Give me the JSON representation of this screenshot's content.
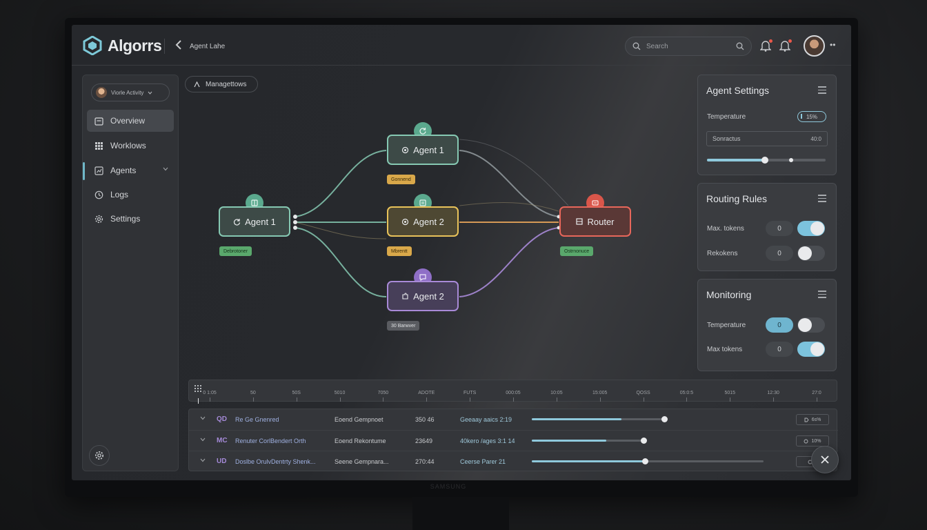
{
  "app": {
    "name": "Algorrs",
    "breadcrumb": "Agent Lahe"
  },
  "search": {
    "placeholder": "Search"
  },
  "sidebar": {
    "workspace": "Viorle Activity",
    "items": [
      {
        "label": "Overview",
        "icon": "calendar-icon"
      },
      {
        "label": "Worklows",
        "icon": "grid-icon"
      },
      {
        "label": "Agents",
        "icon": "chart-icon"
      },
      {
        "label": "Logs",
        "icon": "clock-icon"
      },
      {
        "label": "Settings",
        "icon": "gear-icon"
      }
    ]
  },
  "canvas": {
    "chip": "Managettows",
    "nodes": {
      "agent1_left": {
        "label": "Agent 1",
        "tag": "Debrotoner"
      },
      "agent1_top": {
        "label": "Agent 1",
        "tag": "Gonnend"
      },
      "agent2_mid": {
        "label": "Agent 2",
        "tag": "Mbrentt"
      },
      "agent2_bot": {
        "label": "Agent 2",
        "tag": "30 Barwver"
      },
      "router": {
        "label": "Router",
        "tag": "Ostrnonuce"
      }
    }
  },
  "panels": {
    "agent_settings": {
      "title": "Agent Settings",
      "temperature_label": "Temperature",
      "temperature_value": "15%",
      "field_label": "Sonractus",
      "field_value": "40:0",
      "slider_fraction": 0.49
    },
    "routing_rules": {
      "title": "Routing Rules",
      "rows": [
        {
          "label": "Max. tokens",
          "value": "0",
          "on": true
        },
        {
          "label": "Rekokens",
          "value": "0",
          "on": false
        }
      ]
    },
    "monitoring": {
      "title": "Monitoring",
      "rows": [
        {
          "label": "Temperature",
          "value": "0",
          "on": false,
          "highlight": true
        },
        {
          "label": "Max tokens",
          "value": "0",
          "on": true,
          "highlight": false
        }
      ]
    }
  },
  "timeline": {
    "ticks": [
      "0 1:05",
      "50",
      "50S",
      "5010",
      "7050",
      "ADOTE",
      "FUTS",
      "000:05",
      "10:05",
      "15:005",
      "QOSS",
      "05:0:5",
      "5015",
      "12:30",
      "27:0"
    ]
  },
  "table": {
    "rows": [
      {
        "id": "QD",
        "name": "Re Ge Gnenred",
        "task": "Eoend Gempnoet",
        "time": "350 46",
        "rate": "Geeaay aaics 2:19",
        "progress": 0.68,
        "action": "6s%"
      },
      {
        "id": "MC",
        "name": "Renuter CorlBendert Orth",
        "task": "Eoend Rekontume",
        "time": "23649",
        "rate": "40kero /ages 3:1 14",
        "progress": 0.76,
        "action": "10%"
      },
      {
        "id": "UD",
        "name": "Doslbe OrulvDentrty Shenk...",
        "task": "Seene Gempnara...",
        "time": "270:44",
        "rate": "Ceerse Parer 21",
        "progress": 0.49,
        "action": "0"
      }
    ]
  },
  "colors": {
    "teal": "#86c9b3",
    "yellow": "#e9c35a",
    "purple": "#a98ad8",
    "red": "#e8675b",
    "accent": "#7cc3dd"
  }
}
